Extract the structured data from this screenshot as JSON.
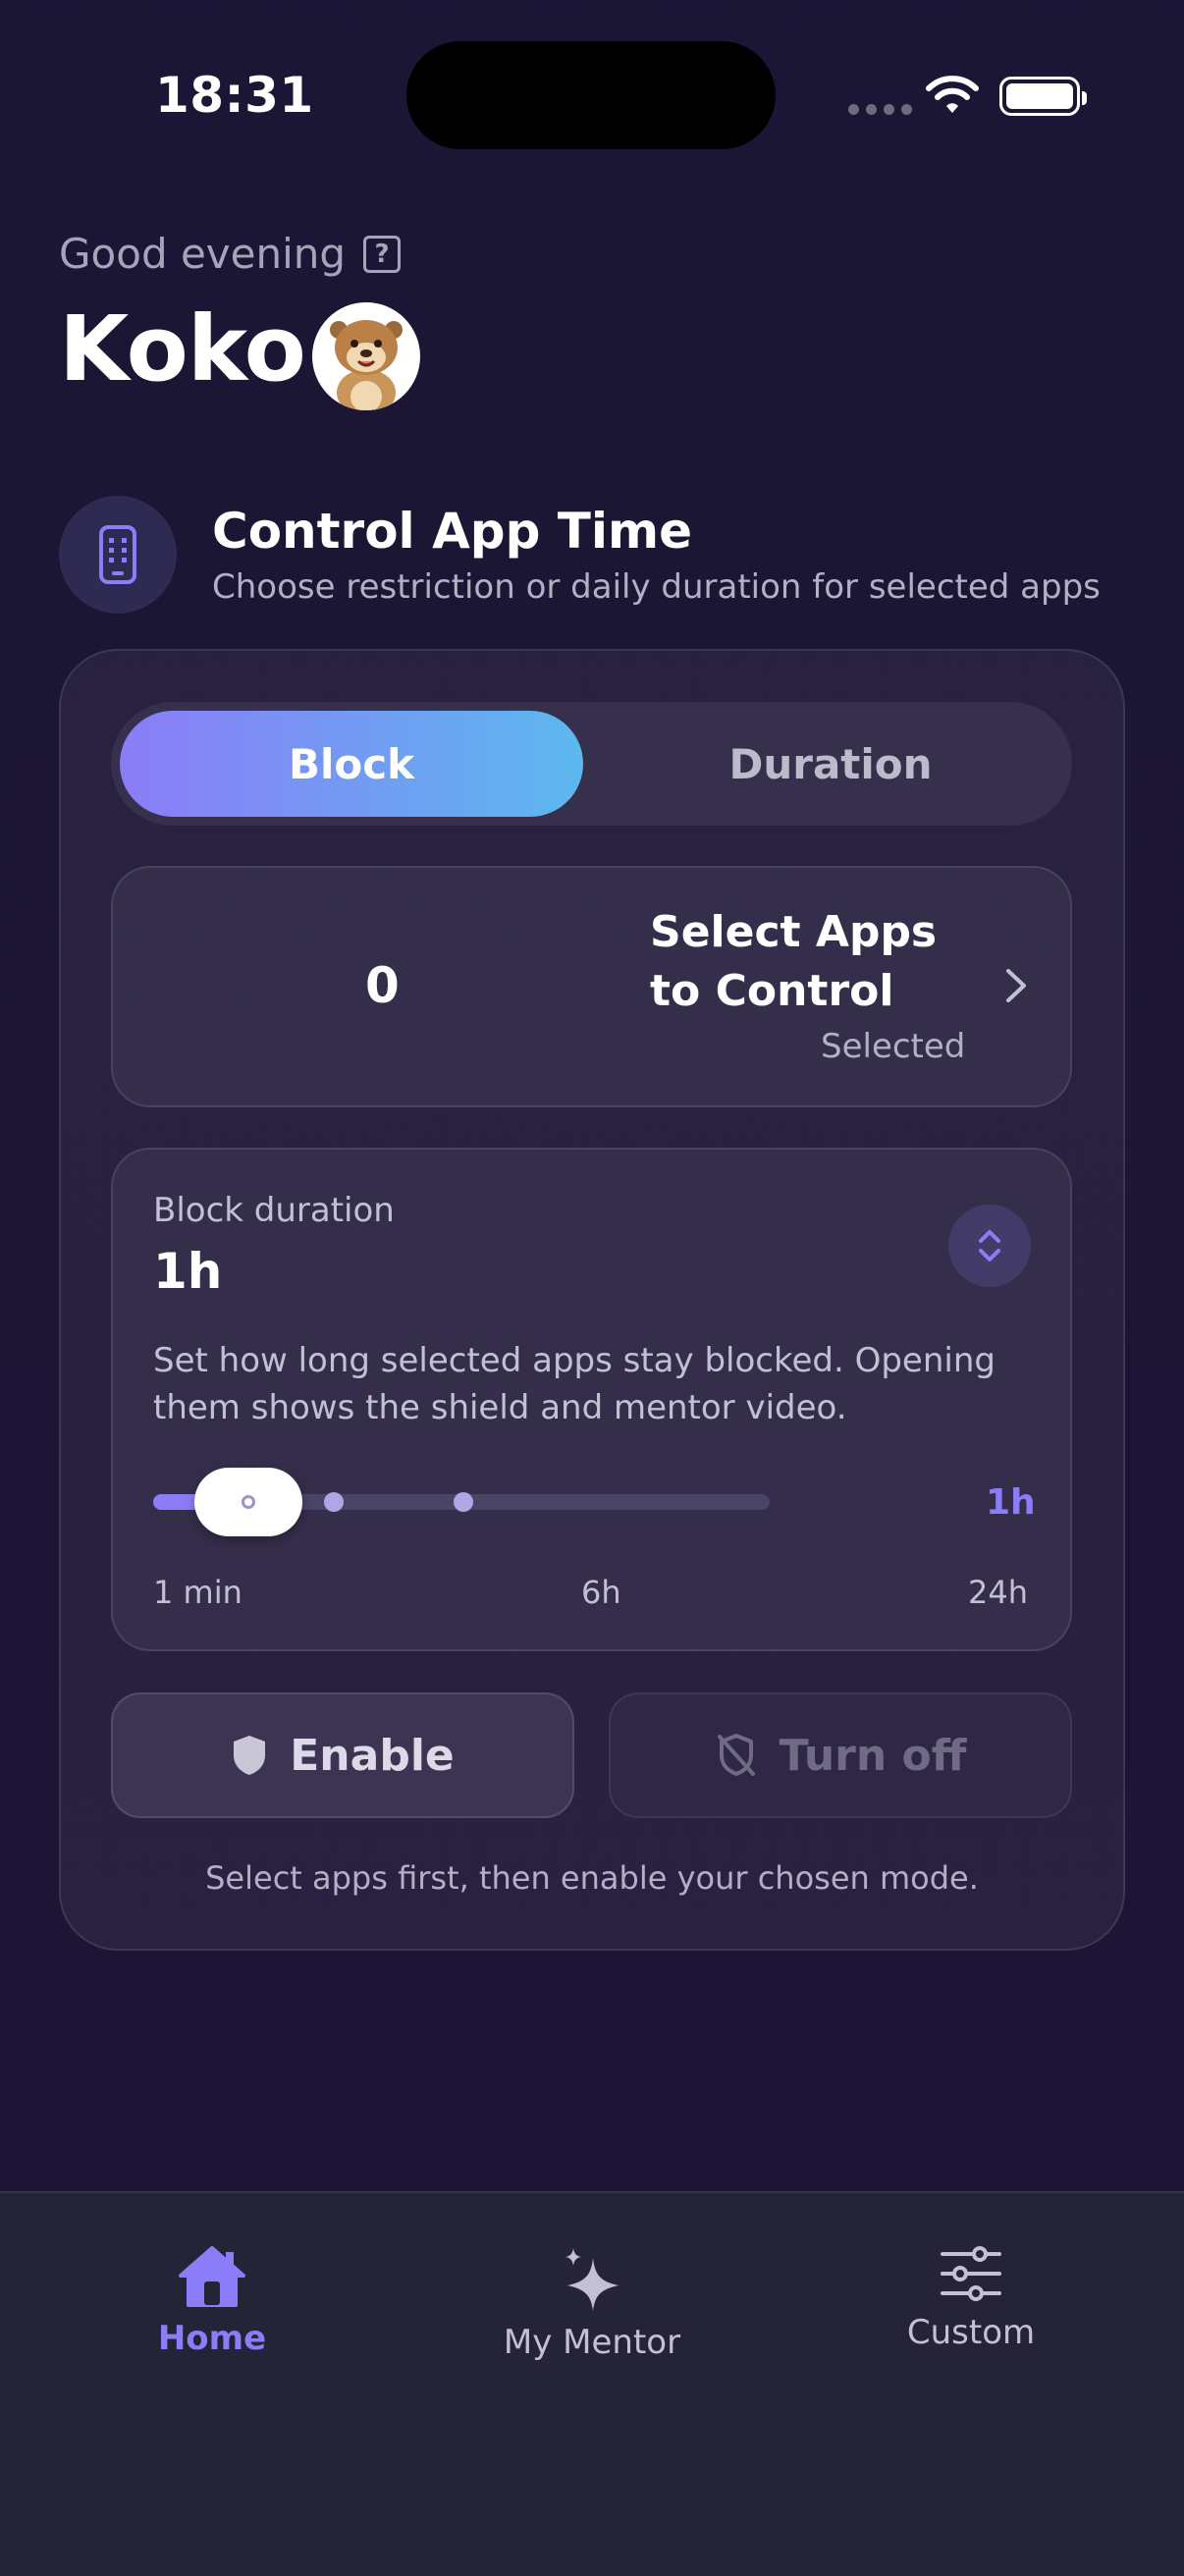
{
  "status_bar": {
    "time": "18:31"
  },
  "header": {
    "greeting": "Good evening",
    "help_glyph": "?",
    "name": "Koko",
    "avatar_icon": "otter-avatar"
  },
  "section": {
    "icon": "phone-icon",
    "title": "Control App Time",
    "subtitle": "Choose restriction or daily duration for selected apps"
  },
  "mode_toggle": {
    "options": [
      "Block",
      "Duration"
    ],
    "selected": "Block"
  },
  "apps_selector": {
    "count": "0",
    "title": "Select Apps to Control",
    "selected_label": "Selected"
  },
  "block_duration": {
    "label": "Block duration",
    "value": "1h",
    "description": "Set how long selected apps stay blocked. Opening them shows the shield and mentor video.",
    "slider": {
      "current_label": "1h",
      "min_label": "1 min",
      "mid_label": "6h",
      "max_label": "24h"
    }
  },
  "actions": {
    "enable_label": "Enable",
    "turn_off_label": "Turn off",
    "hint": "Select apps first, then enable your chosen mode."
  },
  "tab_bar": {
    "tabs": [
      {
        "label": "Home",
        "icon": "home-icon",
        "active": true
      },
      {
        "label": "My Mentor",
        "icon": "sparkle-icon",
        "active": false
      },
      {
        "label": "Custom",
        "icon": "sliders-icon",
        "active": false
      }
    ]
  },
  "colors": {
    "accent": "#8b7cf7",
    "gradient_end": "#5cb8ef",
    "background": "#1b1635"
  }
}
